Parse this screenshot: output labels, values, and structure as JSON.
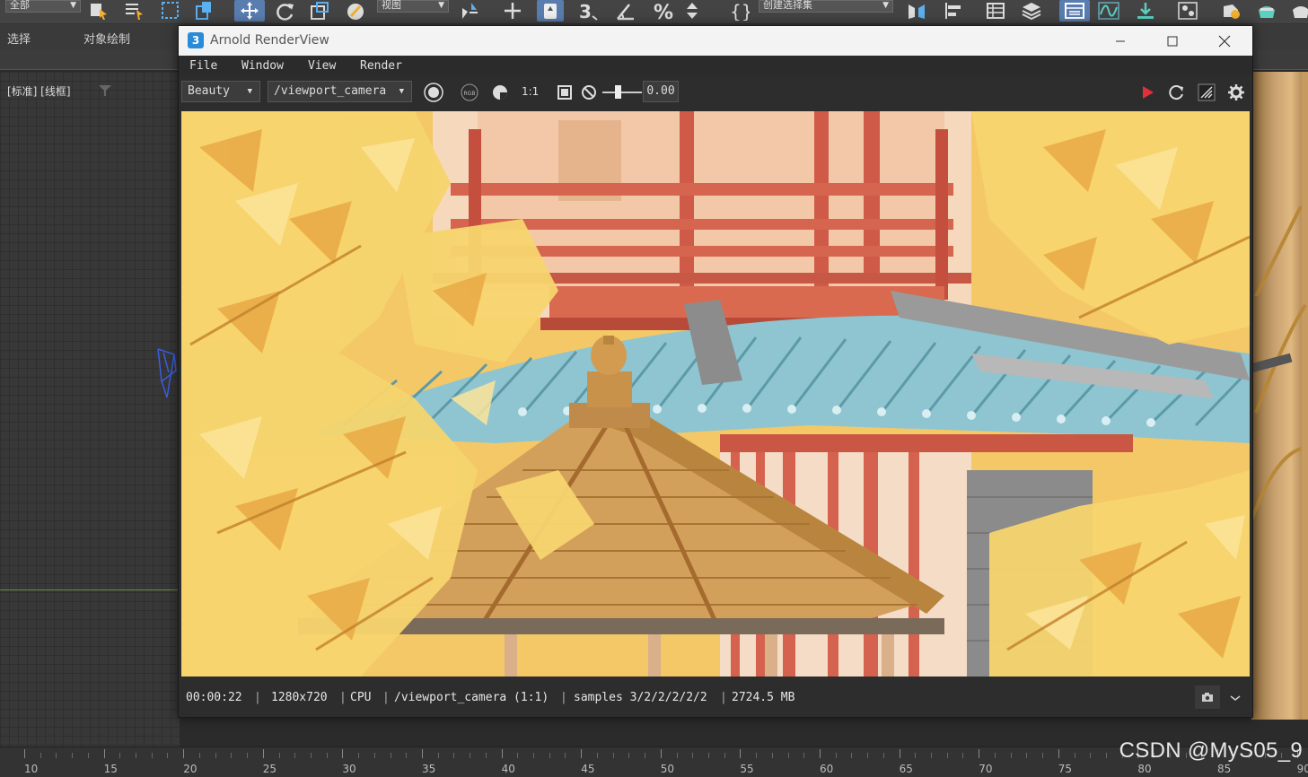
{
  "host": {
    "toolbar": {
      "selection_filter": "全部",
      "reference_coord": "视图",
      "named_selection": "创建选择集"
    },
    "ribbon_tabs": [
      "选择",
      "对象绘制"
    ],
    "viewport": {
      "label": "[标准] [线框]"
    },
    "timeline": {
      "ticks": [
        "10",
        "15",
        "20",
        "25",
        "30",
        "35",
        "40",
        "45",
        "50",
        "55",
        "60",
        "65",
        "70",
        "75",
        "80",
        "85",
        "90"
      ]
    },
    "watermark": "CSDN @MyS05_9"
  },
  "arnold": {
    "title": "Arnold RenderView",
    "app_icon": "3",
    "menu": [
      "File",
      "Window",
      "View",
      "Render"
    ],
    "toolbar": {
      "aov": "Beauty",
      "camera": "/viewport_camera",
      "ratio": "1:1",
      "exposure": "0.00",
      "rgb_label": "RGB"
    },
    "status": {
      "time": "00:00:22",
      "resolution": "1280x720",
      "device": "CPU",
      "camera_ratio": "/viewport_camera (1:1)",
      "samples": "samples 3/2/2/2/2/2",
      "memory": "2724.5 MB"
    },
    "colors": {
      "play_red": "#e0303a",
      "ginkgo": "#f5cf63",
      "pillar_red": "#d86b52",
      "tile_blue": "#8fc6d2",
      "wood": "#c9924a"
    }
  }
}
